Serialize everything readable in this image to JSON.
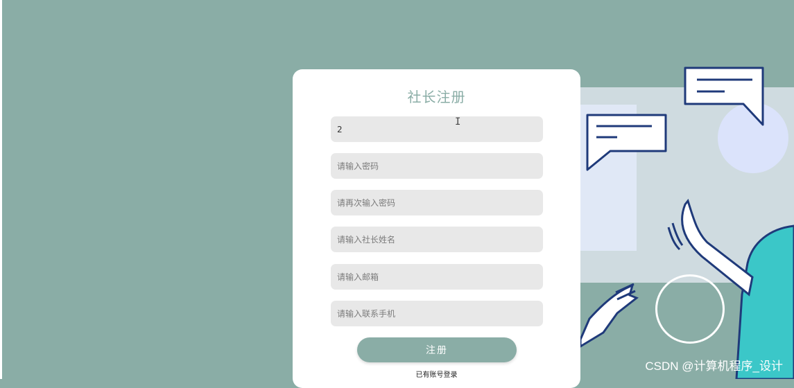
{
  "form": {
    "title": "社长注册",
    "fields": [
      {
        "name": "username",
        "value": "2",
        "placeholder": ""
      },
      {
        "name": "password",
        "value": "",
        "placeholder": "请输入密码"
      },
      {
        "name": "confirm_password",
        "value": "",
        "placeholder": "请再次输入密码"
      },
      {
        "name": "president_name",
        "value": "",
        "placeholder": "请输入社长姓名"
      },
      {
        "name": "email",
        "value": "",
        "placeholder": "请输入邮箱"
      },
      {
        "name": "phone",
        "value": "",
        "placeholder": "请输入联系手机"
      }
    ],
    "submit_label": "注册",
    "login_link": "已有账号登录"
  },
  "watermark": "CSDN @计算机程序_设计",
  "colors": {
    "background": "#8aada6",
    "card": "#ffffff",
    "input_bg": "#e8e8e8",
    "accent": "#8aada6",
    "illustration_stroke": "#1f3a7a",
    "illustration_teal": "#3bc7c8"
  }
}
